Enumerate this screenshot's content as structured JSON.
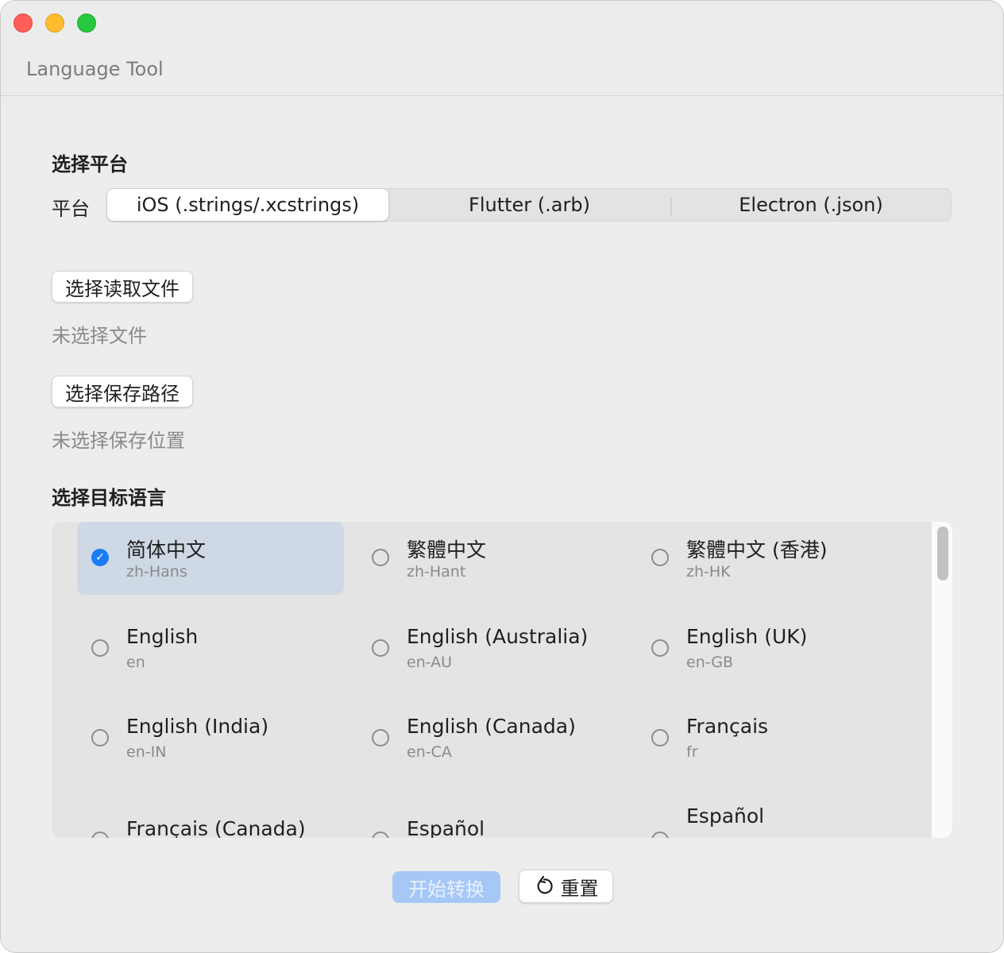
{
  "window": {
    "title": "Language Tool"
  },
  "platform_section": {
    "heading": "选择平台",
    "label": "平台",
    "options": [
      "iOS (.strings/.xcstrings)",
      "Flutter (.arb)",
      "Electron (.json)"
    ],
    "selected": "iOS (.strings/.xcstrings)"
  },
  "files": {
    "read_button": "选择读取文件",
    "read_status": "未选择文件",
    "save_button": "选择保存路径",
    "save_status": "未选择保存位置"
  },
  "languages_section": {
    "heading": "选择目标语言",
    "items": [
      {
        "name": "简体中文",
        "code": "zh-Hans",
        "selected": true
      },
      {
        "name": "繁體中文",
        "code": "zh-Hant",
        "selected": false
      },
      {
        "name": "繁體中文 (香港)",
        "code": "zh-HK",
        "selected": false
      },
      {
        "name": "English",
        "code": "en",
        "selected": false
      },
      {
        "name": "English (Australia)",
        "code": "en-AU",
        "selected": false
      },
      {
        "name": "English (UK)",
        "code": "en-GB",
        "selected": false
      },
      {
        "name": "English (India)",
        "code": "en-IN",
        "selected": false
      },
      {
        "name": "English (Canada)",
        "code": "en-CA",
        "selected": false
      },
      {
        "name": "Français",
        "code": "fr",
        "selected": false
      },
      {
        "name": "Français (Canada)",
        "code": "",
        "selected": false
      },
      {
        "name": "Español",
        "code": "",
        "selected": false
      },
      {
        "name": "Español",
        "code": "",
        "selected": false
      }
    ]
  },
  "actions": {
    "start_label": "开始转换",
    "reset_label": "重置",
    "reset_icon": "reset-arrow-icon"
  },
  "colors": {
    "accent": "#1a7cf5",
    "selected_row": "#cfd8e5",
    "start_disabled": "#a6c8f7"
  }
}
